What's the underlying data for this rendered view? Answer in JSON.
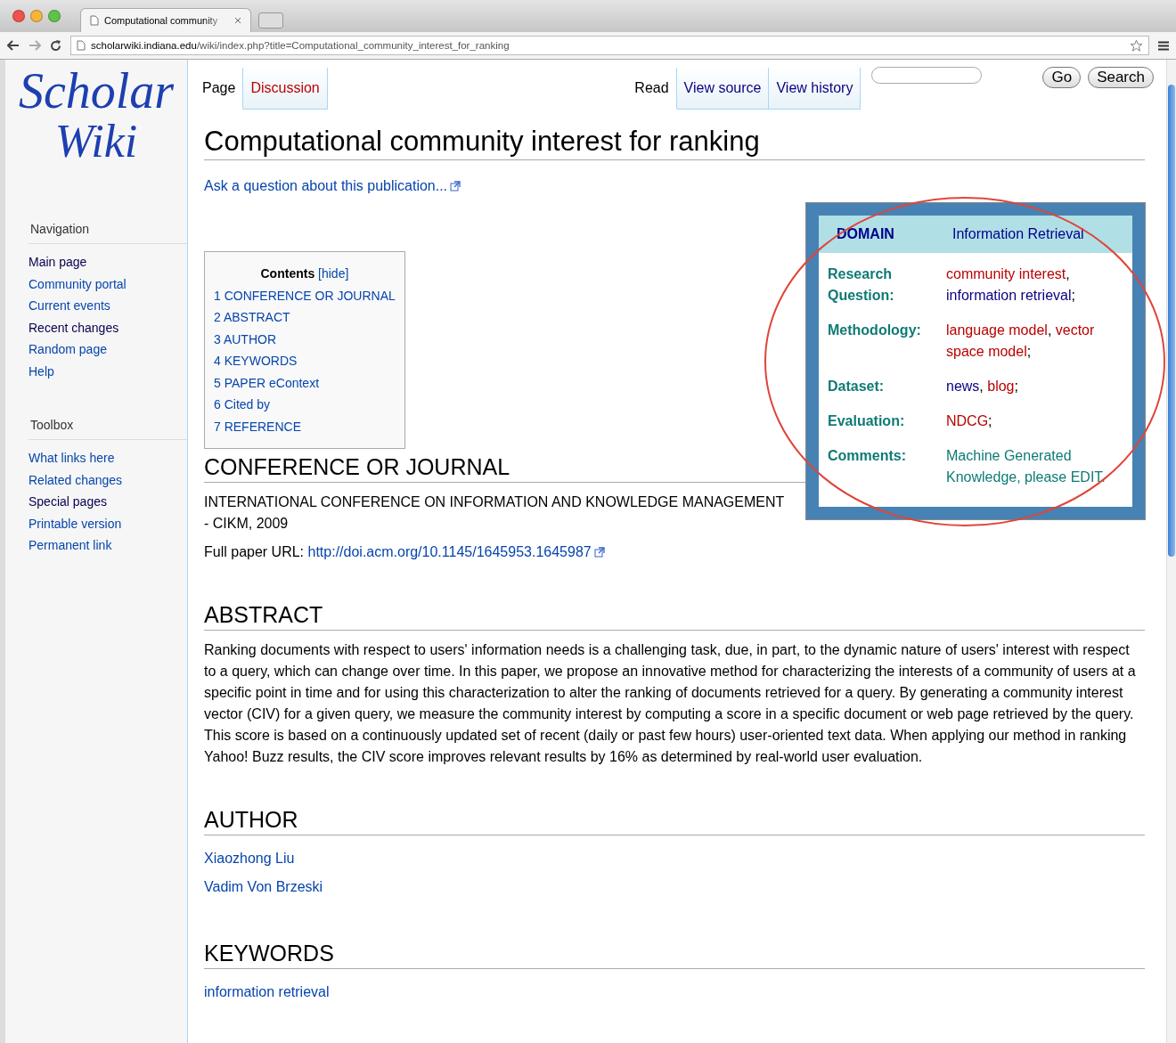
{
  "browser": {
    "tab_title": "Computational community",
    "url_host": "scholarwiki.indiana.edu",
    "url_path": "/wiki/index.php?title=Computational_community_interest_for_ranking"
  },
  "logo": {
    "line_1": "Scholar",
    "line_2": "Wiki"
  },
  "page_tabs": [
    {
      "label": "Page",
      "selected": true,
      "missing": false
    },
    {
      "label": "Discussion",
      "selected": false,
      "missing": true
    }
  ],
  "view_tabs": [
    {
      "label": "Read",
      "selected": true
    },
    {
      "label": "View source",
      "selected": false
    },
    {
      "label": "View history",
      "selected": false
    }
  ],
  "search": {
    "buttons": [
      "Go",
      "Search"
    ]
  },
  "sidebar": [
    {
      "title": "Navigation",
      "items": [
        {
          "label": "Main page",
          "visited": true
        },
        {
          "label": "Community portal",
          "visited": false
        },
        {
          "label": "Current events",
          "visited": false
        },
        {
          "label": "Recent changes",
          "visited": true
        },
        {
          "label": "Random page",
          "visited": false
        },
        {
          "label": "Help",
          "visited": false
        }
      ]
    },
    {
      "title": "Toolbox",
      "items": [
        {
          "label": "What links here",
          "visited": false
        },
        {
          "label": "Related changes",
          "visited": false
        },
        {
          "label": "Special pages",
          "visited": true
        },
        {
          "label": "Printable version",
          "visited": false
        },
        {
          "label": "Permanent link",
          "visited": false
        }
      ]
    }
  ],
  "title": "Computational community interest for ranking",
  "ask_link": "Ask a question about this publication...",
  "toc": {
    "title": "Contents",
    "toggle": "[hide]",
    "items": [
      "1 CONFERENCE OR JOURNAL",
      "2 ABSTRACT",
      "3 AUTHOR",
      "4 KEYWORDS",
      "5 PAPER eContext",
      "6 Cited by",
      "7 REFERENCE"
    ]
  },
  "infobox": {
    "domain_label": "DOMAIN",
    "domain_value": "Information Retrieval",
    "rows": [
      {
        "label": "Research Question:",
        "parts": [
          {
            "text": "community interest",
            "kind": "redlink"
          },
          {
            "text": ", ",
            "kind": "text"
          },
          {
            "text": "information retrieval",
            "kind": "link"
          },
          {
            "text": ";",
            "kind": "text"
          }
        ]
      },
      {
        "label": "Methodology:",
        "parts": [
          {
            "text": "language model",
            "kind": "redlink"
          },
          {
            "text": ", ",
            "kind": "text"
          },
          {
            "text": "vector space model",
            "kind": "redlink"
          },
          {
            "text": ";",
            "kind": "text"
          }
        ]
      },
      {
        "label": "Dataset:",
        "parts": [
          {
            "text": "news",
            "kind": "link"
          },
          {
            "text": ", ",
            "kind": "text"
          },
          {
            "text": "blog",
            "kind": "redlink"
          },
          {
            "text": ";",
            "kind": "text"
          }
        ]
      },
      {
        "label": "Evaluation:",
        "parts": [
          {
            "text": "NDCG",
            "kind": "redlink"
          },
          {
            "text": ";",
            "kind": "text"
          }
        ]
      },
      {
        "label": "Comments:",
        "parts": [
          {
            "text": "Machine Generated Knowledge, please EDIT.",
            "kind": "note"
          }
        ]
      }
    ]
  },
  "sections": [
    {
      "heading": "CONFERENCE OR JOURNAL",
      "blocks": [
        {
          "kind": "text",
          "text": "INTERNATIONAL CONFERENCE ON INFORMATION AND KNOWLEDGE MANAGEMENT - CIKM, 2009"
        },
        {
          "kind": "url",
          "label": "Full paper URL:",
          "link": "http://doi.acm.org/10.1145/1645953.1645987"
        }
      ]
    },
    {
      "heading": "ABSTRACT",
      "blocks": [
        {
          "kind": "text",
          "text": "Ranking documents with respect to users' information needs is a challenging task, due, in part, to the dynamic nature of users' interest with respect to a query, which can change over time. In this paper, we propose an innovative method for characterizing the interests of a community of users at a specific point in time and for using this characterization to alter the ranking of documents retrieved for a query. By generating a community interest vector (CIV) for a given query, we measure the community interest by computing a score in a specific document or web page retrieved by the query. This score is based on a continuously updated set of recent (daily or past few hours) user-oriented text data. When applying our method in ranking Yahoo! Buzz results, the CIV score improves relevant results by 16% as determined by real-world user evaluation."
        }
      ]
    },
    {
      "heading": "AUTHOR",
      "blocks": [
        {
          "kind": "link",
          "text": "Xiaozhong Liu"
        },
        {
          "kind": "link",
          "text": "Vadim Von Brzeski"
        }
      ]
    },
    {
      "heading": "KEYWORDS",
      "blocks": [
        {
          "kind": "link",
          "text": "information retrieval"
        }
      ]
    }
  ]
}
